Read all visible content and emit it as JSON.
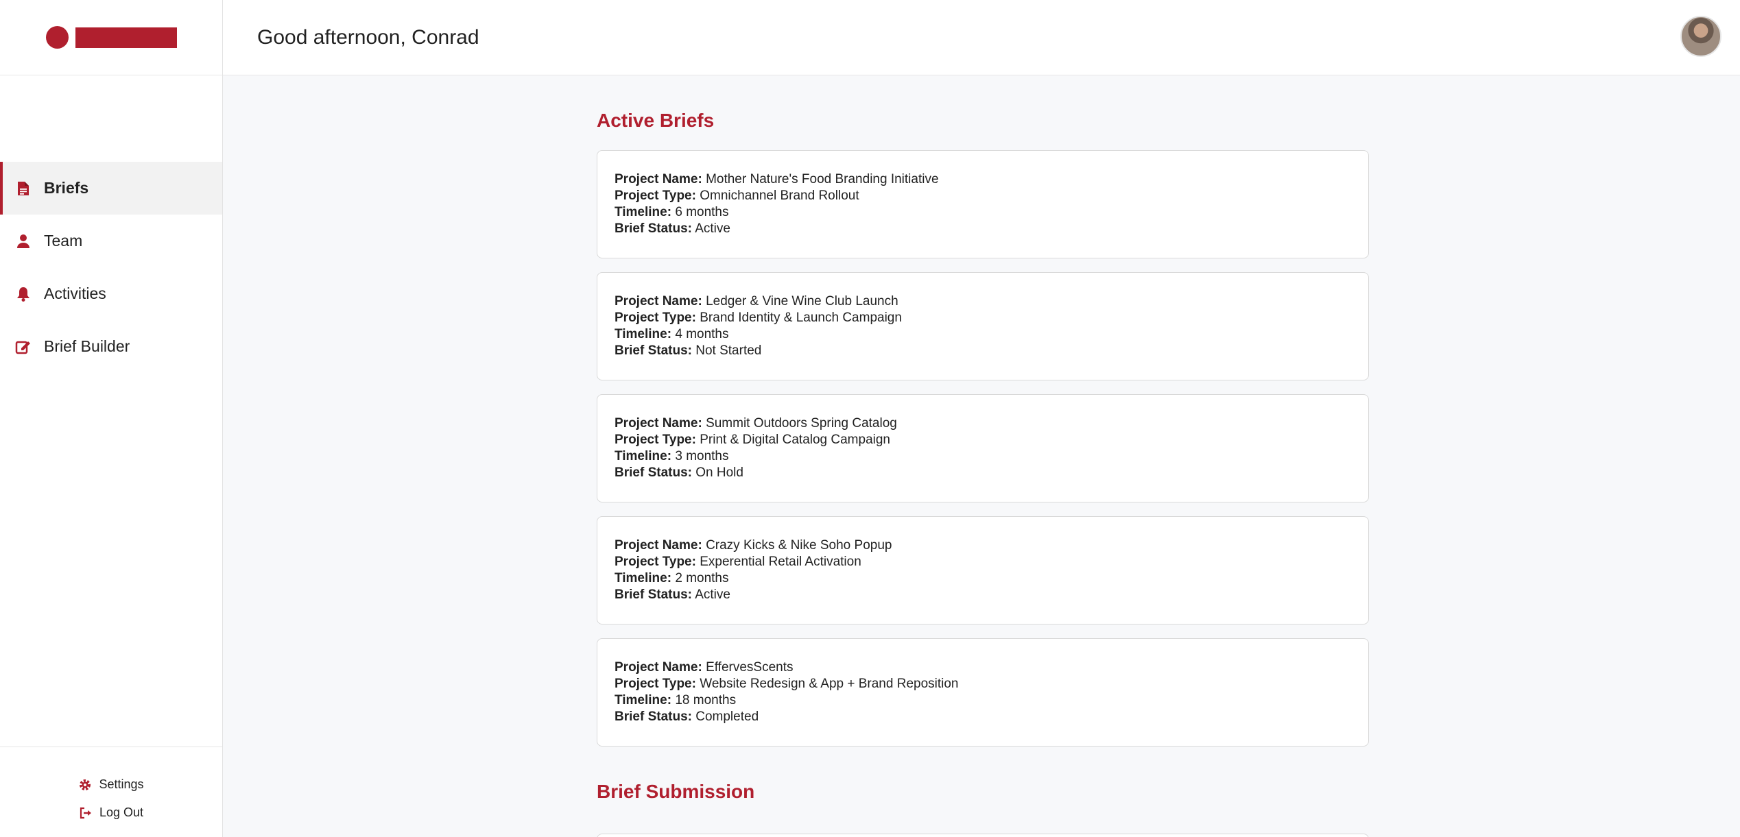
{
  "header": {
    "greeting": "Good afternoon, Conrad"
  },
  "sidebar": {
    "items": [
      {
        "label": "Briefs",
        "icon": "document-icon",
        "active": true
      },
      {
        "label": "Team",
        "icon": "user-icon",
        "active": false
      },
      {
        "label": "Activities",
        "icon": "bell-icon",
        "active": false
      },
      {
        "label": "Brief Builder",
        "icon": "edit-icon",
        "active": false
      }
    ],
    "bottom": [
      {
        "label": "Settings",
        "icon": "gear-icon"
      },
      {
        "label": "Log Out",
        "icon": "logout-icon"
      }
    ]
  },
  "sections": {
    "active_title": "Active Briefs",
    "submission_title": "Brief Submission"
  },
  "field_labels": {
    "name": "Project Name:",
    "type": "Project Type:",
    "timeline": "Timeline:",
    "status": "Brief Status:"
  },
  "briefs": [
    {
      "name": "Mother Nature's Food Branding Initiative",
      "type": "Omnichannel Brand Rollout",
      "timeline": "6 months",
      "status": "Active"
    },
    {
      "name": "Ledger & Vine Wine Club Launch",
      "type": "Brand Identity & Launch Campaign",
      "timeline": "4 months",
      "status": "Not Started"
    },
    {
      "name": "Summit Outdoors Spring Catalog",
      "type": "Print & Digital Catalog Campaign",
      "timeline": "3 months",
      "status": "On Hold"
    },
    {
      "name": "Crazy Kicks & Nike Soho Popup",
      "type": "Experential Retail Activation",
      "timeline": "2 months",
      "status": "Active"
    },
    {
      "name": "EffervesScents",
      "type": "Website Redesign & App + Brand Reposition",
      "timeline": "18 months",
      "status": "Completed"
    }
  ],
  "colors": {
    "accent": "#b01f2e",
    "background": "#f7f8fa"
  }
}
